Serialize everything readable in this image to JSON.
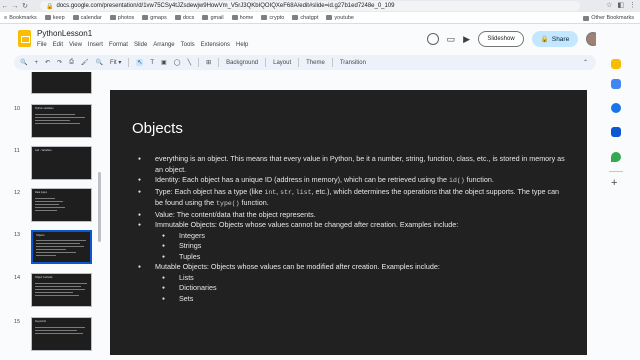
{
  "browser": {
    "url": "docs.google.com/presentation/d/1vw75CSy4tJZsdewjw9HowVm_V5rJ3QKbIQOIQXeF68A/edit#slide=id.g27b1ed7248e_0_109",
    "bookmarks": [
      "Bookmarks",
      "keep",
      "calendar",
      "photos",
      "gmaps",
      "docs",
      "gmail",
      "home",
      "crypto",
      "chatgpt",
      "youtube"
    ],
    "other_bookmarks": "Other Bookmarks"
  },
  "app": {
    "doc_title": "PythonLesson1",
    "menus": [
      "File",
      "Edit",
      "View",
      "Insert",
      "Format",
      "Slide",
      "Arrange",
      "Tools",
      "Extensions",
      "Help"
    ],
    "slideshow_label": "Slideshow",
    "share_label": "Share"
  },
  "toolbar": {
    "fit_label": "Fit",
    "background_label": "Background",
    "layout_label": "Layout",
    "theme_label": "Theme",
    "transition_label": "Transition"
  },
  "filmstrip": {
    "slides": [
      {
        "number": "10",
        "title": "Python variables"
      },
      {
        "number": "11",
        "title": "Lab - Variables"
      },
      {
        "number": "12",
        "title": "Data types"
      },
      {
        "number": "13",
        "title": "Objects",
        "selected": true
      },
      {
        "number": "14",
        "title": "Object methods"
      },
      {
        "number": "15",
        "title": "Keywords"
      }
    ]
  },
  "slide": {
    "title": "Objects",
    "b1": "everything is an object. This means that every value in Python, be it a number, string, function, class, etc., is stored in memory as an object.",
    "b2_pre": "Identity: Each object has a unique ID (address in memory), which can be retrieved using the ",
    "b2_code": "id()",
    "b2_post": " function.",
    "b3_pre": "Type: Each object has a type (like ",
    "b3_c1": "int",
    "b3_c2": "str",
    "b3_c3": "list",
    "b3_mid": ", etc.), which determines the operations that the object supports. The type can be found using the ",
    "b3_c4": "type()",
    "b3_post": " function.",
    "sep": ", ",
    "b4": "Value: The content/data that the object represents.",
    "b5": "Immutable Objects: Objects whose values cannot be changed after creation. Examples include:",
    "immutable": [
      "Integers",
      "Strings",
      "Tuples"
    ],
    "b6": "Mutable Objects: Objects whose values can be modified after creation. Examples include:",
    "mutable": [
      "Lists",
      "Dictionaries",
      "Sets"
    ]
  },
  "colors": {
    "accent": "#0b57d0",
    "share_bg": "#c2e7ff",
    "slide_bg": "#212121",
    "app_logo": "#fbbc04"
  }
}
